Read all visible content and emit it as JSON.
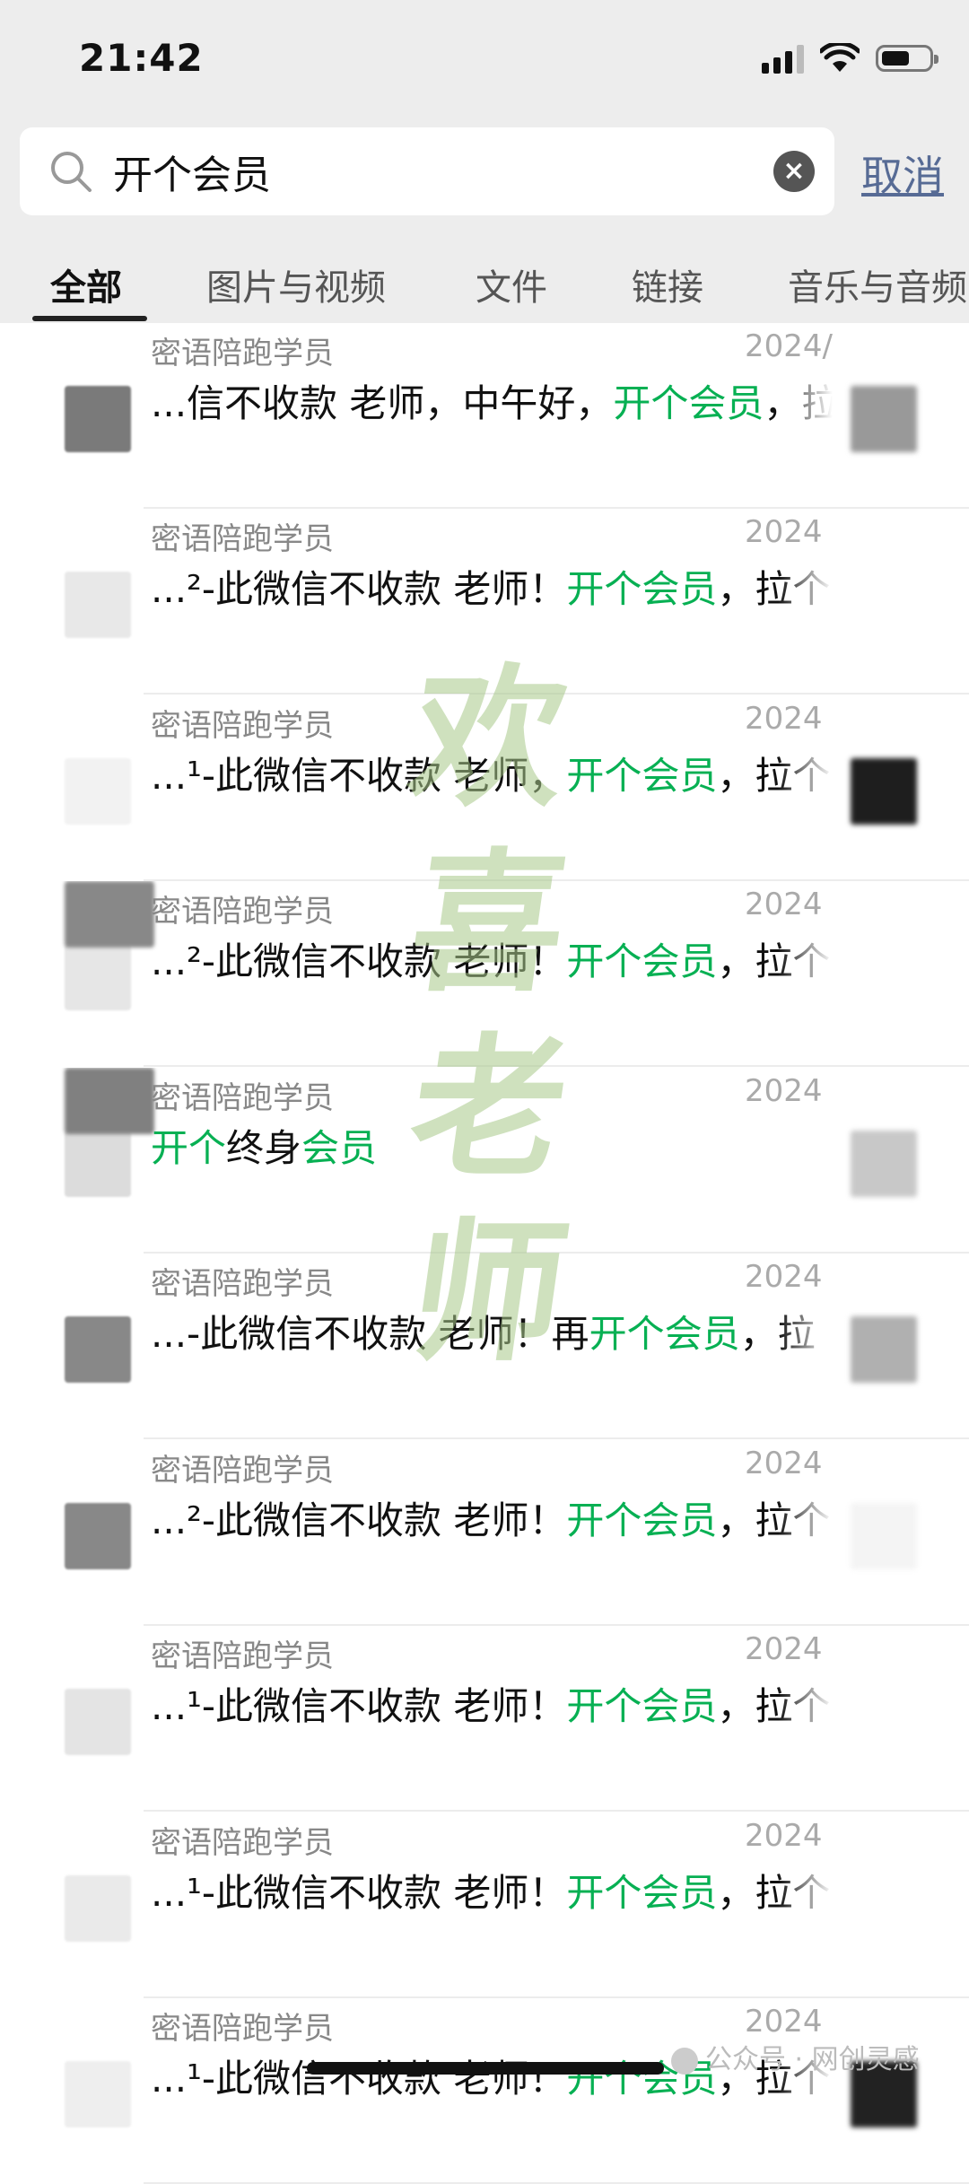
{
  "status_bar": {
    "time": "21:42"
  },
  "search": {
    "query": "开个会员",
    "cancel_label": "取消"
  },
  "tabs": [
    "全部",
    "图片与视频",
    "文件",
    "链接",
    "音乐与音频"
  ],
  "results": [
    {
      "name": "密语陪跑学员",
      "date": "2024/",
      "pre": "...信不收款 老师，中午好，",
      "hl": "开个会员",
      "post": "，拉"
    },
    {
      "name": "密语陪跑学员",
      "date": "2024",
      "pre": "...²-此微信不收款 老师！",
      "hl": "开个会员",
      "post": "，拉个"
    },
    {
      "name": "密语陪跑学员",
      "date": "2024",
      "pre": "...¹-此微信不收款 老师，",
      "hl": "开个会员",
      "post": "，拉个"
    },
    {
      "name": "密语陪跑学员",
      "date": "2024",
      "pre": "...²-此微信不收款 老师！",
      "hl": "开个会员",
      "post": "，拉个"
    },
    {
      "name": "密语陪跑学员",
      "date": "2024",
      "pre": "",
      "hl": "开个",
      "mid": "终身",
      "hl2": "会员",
      "post": ""
    },
    {
      "name": "密语陪跑学员",
      "date": "2024",
      "pre": "...-此微信不收款 老师！再",
      "hl": "开个会员",
      "post": "，拉"
    },
    {
      "name": "密语陪跑学员",
      "date": "2024",
      "pre": "...²-此微信不收款 老师！",
      "hl": "开个会员",
      "post": "，拉个"
    },
    {
      "name": "密语陪跑学员",
      "date": "2024",
      "pre": "...¹-此微信不收款 老师！",
      "hl": "开个会员",
      "post": "，拉个"
    },
    {
      "name": "密语陪跑学员",
      "date": "2024",
      "pre": "...¹-此微信不收款 老师！",
      "hl": "开个会员",
      "post": "，拉个"
    },
    {
      "name": "密语陪跑学员",
      "date": "2024",
      "pre": "...¹-此微信不收款 老师！",
      "hl": "开个会员",
      "post": "，拉个"
    }
  ],
  "watermark": [
    "欢",
    "喜",
    "老",
    "师"
  ],
  "credit": "公众号 · 网创灵感",
  "colors": {
    "highlight": "#07b053",
    "link": "#576b95",
    "header_bg": "#ededed"
  }
}
